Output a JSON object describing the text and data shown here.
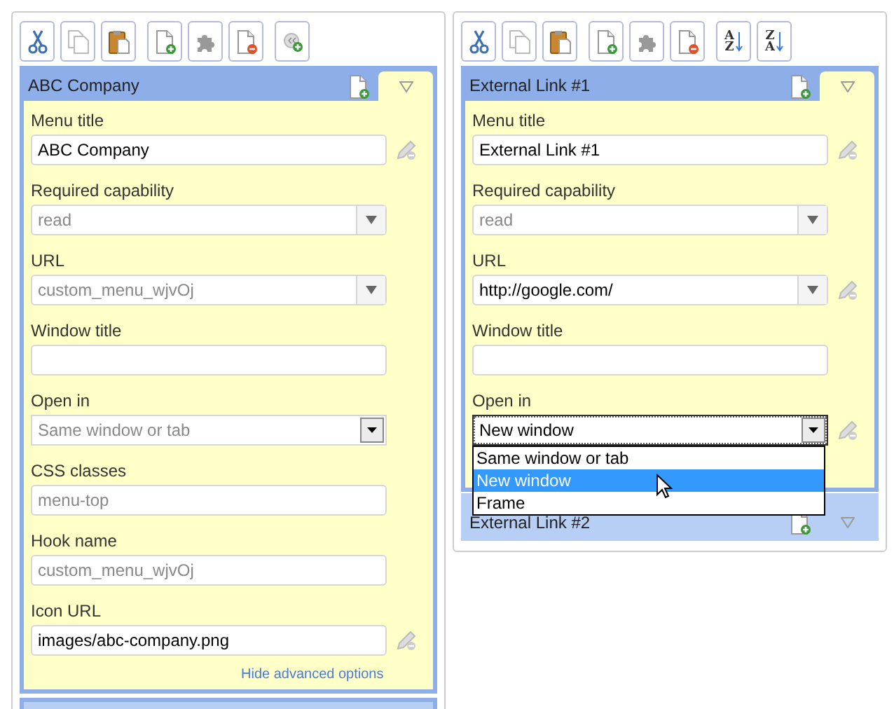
{
  "panels": [
    {
      "toolbar_groups": [
        [
          {
            "kind": "cut"
          },
          {
            "kind": "copy"
          },
          {
            "kind": "paste"
          }
        ],
        [
          {
            "kind": "new"
          },
          {
            "kind": "puzzle"
          },
          {
            "kind": "delete"
          }
        ],
        [
          {
            "kind": "separator-add"
          }
        ]
      ],
      "items": [
        {
          "title": "ABC Company",
          "expanded": true,
          "fields": [
            {
              "label": "Menu title",
              "kind": "text",
              "value": "ABC Company",
              "default": false,
              "resettable": true
            },
            {
              "label": "Required capability",
              "kind": "combo",
              "value": "read",
              "default": true,
              "resettable": false
            },
            {
              "label": "URL",
              "kind": "combo",
              "value": "custom_menu_wjvOj",
              "default": true,
              "resettable": false
            },
            {
              "label": "Window title",
              "kind": "text",
              "default": false,
              "resettable": false
            },
            {
              "label": "Open in",
              "kind": "select",
              "value": "Same window or tab",
              "default": true,
              "resettable": false
            },
            {
              "label": "CSS classes",
              "kind": "text",
              "value": "menu-top",
              "default": true,
              "resettable": false
            },
            {
              "label": "Hook name",
              "kind": "text",
              "value": "custom_menu_wjvOj",
              "default": true,
              "resettable": false
            },
            {
              "label": "Icon URL",
              "kind": "text",
              "value": "images/abc-company.png",
              "default": false,
              "resettable": true
            }
          ],
          "footer_link": "Hide advanced options"
        }
      ],
      "more_below": true
    },
    {
      "toolbar_groups": [
        [
          {
            "kind": "cut"
          },
          {
            "kind": "copy"
          },
          {
            "kind": "paste"
          }
        ],
        [
          {
            "kind": "new"
          },
          {
            "kind": "puzzle"
          },
          {
            "kind": "delete"
          }
        ],
        [
          {
            "kind": "sort",
            "letters": [
              "A",
              "Z"
            ]
          },
          {
            "kind": "sort",
            "letters": [
              "Z",
              "A"
            ]
          }
        ]
      ],
      "items": [
        {
          "title": "External Link #1",
          "expanded": true,
          "fields": [
            {
              "label": "Menu title",
              "kind": "text",
              "value": "External Link #1",
              "default": false,
              "resettable": true
            },
            {
              "label": "Required capability",
              "kind": "combo",
              "value": "read",
              "default": true,
              "resettable": false
            },
            {
              "label": "URL",
              "kind": "combo",
              "value": "http://google.com/",
              "default": false,
              "resettable": true
            },
            {
              "label": "Window title",
              "kind": "text",
              "default": false,
              "resettable": false
            },
            {
              "label": "Open in",
              "kind": "select",
              "value": "New window",
              "default": false,
              "resettable": true,
              "open": true,
              "options": [
                {
                  "label": "Same window or tab",
                  "selected": false
                },
                {
                  "label": "New window",
                  "selected": true
                },
                {
                  "label": "Frame",
                  "selected": false
                }
              ]
            }
          ]
        },
        {
          "title": "External Link #2",
          "expanded": false
        }
      ],
      "more_below": false
    }
  ]
}
